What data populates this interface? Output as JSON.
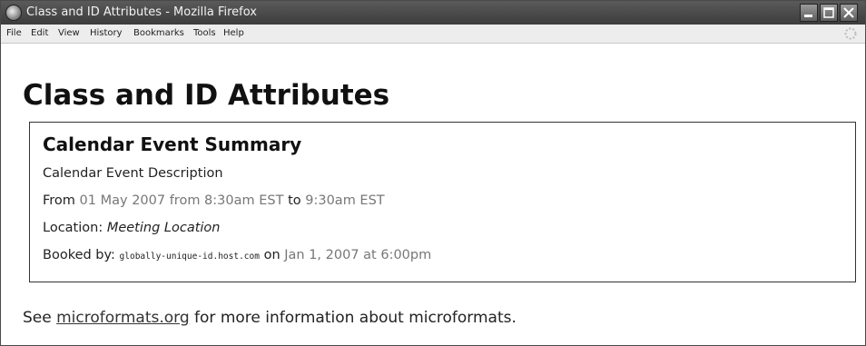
{
  "window": {
    "title": "Class and ID Attributes - Mozilla Firefox"
  },
  "menu": {
    "items": [
      "File",
      "Edit",
      "View",
      "History",
      "Bookmarks",
      "Tools",
      "Help"
    ]
  },
  "page": {
    "heading": "Class and ID Attributes",
    "event": {
      "summary": "Calendar Event Summary",
      "description": "Calendar Event Description",
      "from_label": "From",
      "start": "01 May 2007 from 8:30am EST",
      "to_label": "to",
      "end": "9:30am EST",
      "location_label": "Location:",
      "location": "Meeting Location",
      "booked_label": "Booked by:",
      "booked_id": "globally-unique-id.host.com",
      "on_label": "on",
      "booked_date": "Jan 1, 2007 at 6:00pm"
    },
    "footer": {
      "prefix": "See",
      "link": "microformats.org",
      "suffix": "for more information about microformats."
    }
  },
  "icons": {
    "app": "firefox-icon",
    "minimize": "minimize-icon",
    "maximize": "maximize-icon",
    "close": "close-icon",
    "throbber": "throbber-icon"
  }
}
